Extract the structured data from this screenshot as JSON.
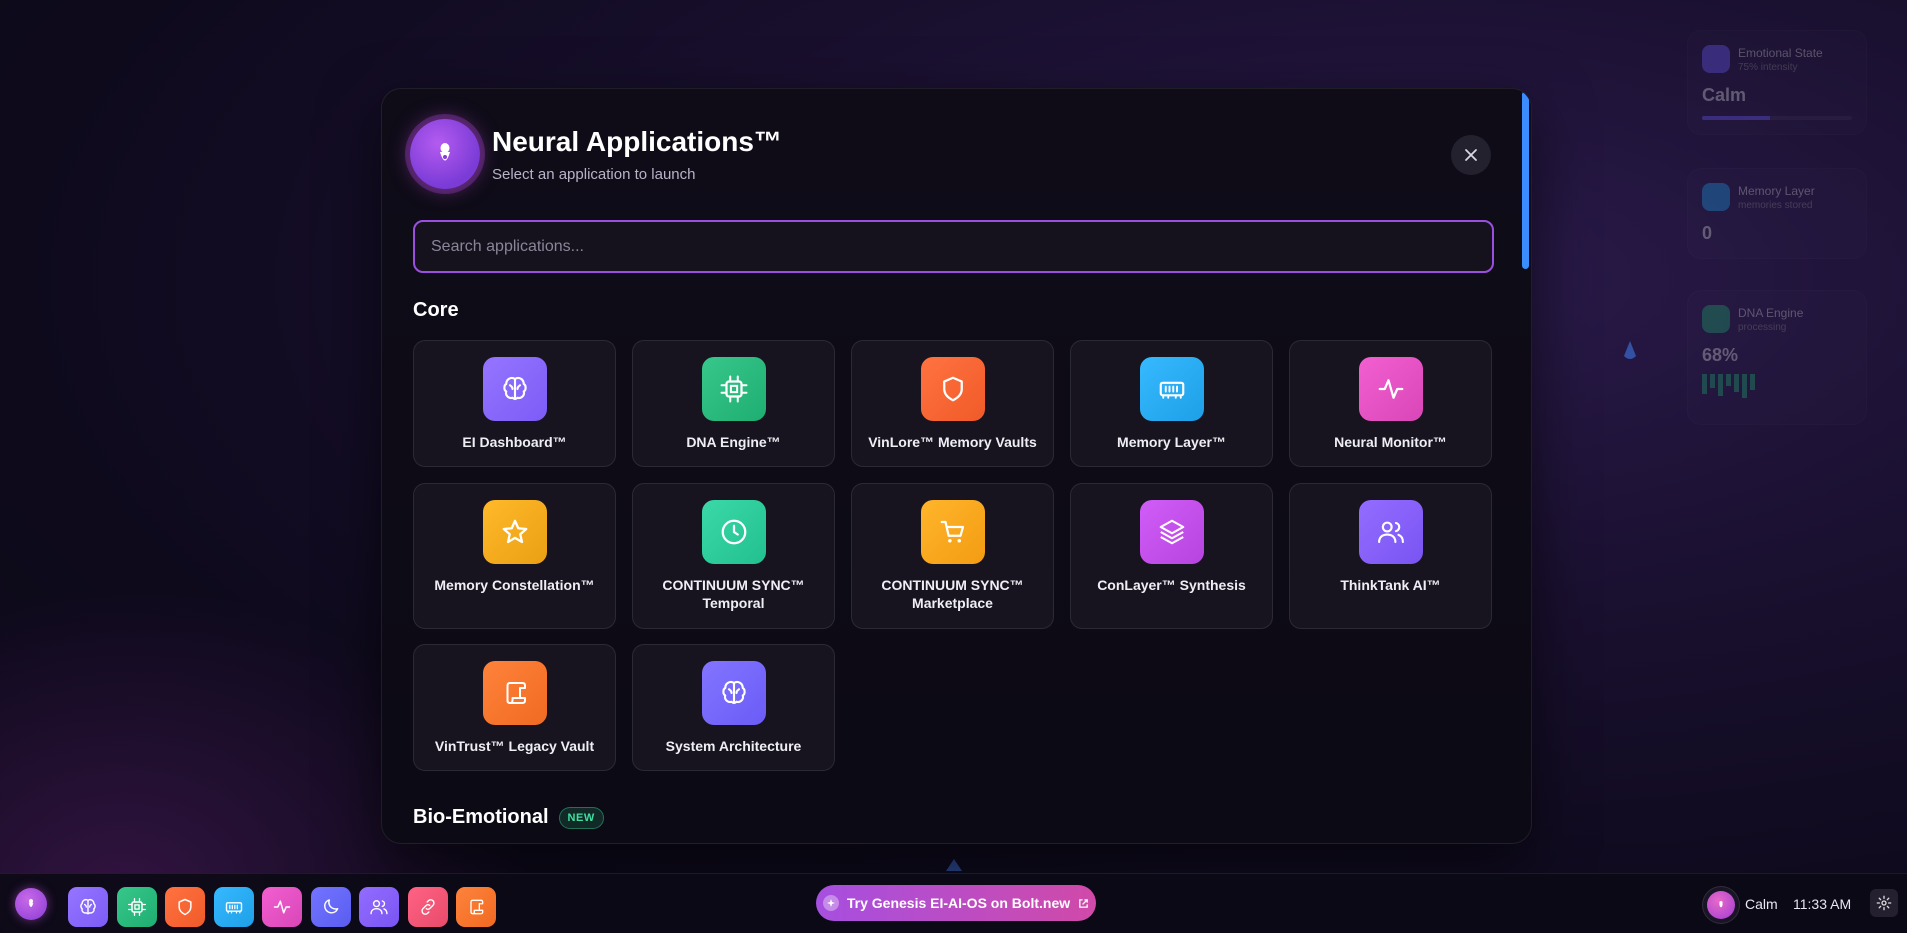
{
  "modal": {
    "title": "Neural Applications™",
    "subtitle": "Select an application to launch",
    "search_placeholder": "Search applications..."
  },
  "sections": {
    "core": "Core",
    "bio": "Bio-Emotional",
    "bio_badge": "NEW"
  },
  "apps": [
    {
      "label": "EI Dashboard™",
      "icon": "brain-icon",
      "color": "#7c5cf6"
    },
    {
      "label": "DNA Engine™",
      "icon": "chip-icon",
      "color": "#1fae72"
    },
    {
      "label": "VinLore™ Memory Vaults",
      "icon": "shield-icon",
      "color": "#f05a28"
    },
    {
      "label": "Memory Layer™",
      "icon": "memory-icon",
      "color": "#1ea0e8"
    },
    {
      "label": "Neural Monitor™",
      "icon": "activity-icon",
      "color": "#d946b8"
    },
    {
      "label": "Memory Constellation™",
      "icon": "star-icon",
      "color": "#eaa012"
    },
    {
      "label": "CONTINUUM SYNC™ Temporal",
      "icon": "clock-icon",
      "color": "#22c08f"
    },
    {
      "label": "CONTINUUM SYNC™ Marketplace",
      "icon": "cart-icon",
      "color": "#f39c12"
    },
    {
      "label": "ConLayer™ Synthesis",
      "icon": "layers-icon",
      "color": "#b844e0"
    },
    {
      "label": "ThinkTank AI™",
      "icon": "users-icon",
      "color": "#7a54f2"
    },
    {
      "label": "VinTrust™ Legacy Vault",
      "icon": "scroll-icon",
      "color": "#f06a22"
    },
    {
      "label": "System Architecture",
      "icon": "brain-icon",
      "color": "#6a5cf6"
    }
  ],
  "taskbar": {
    "apps": [
      {
        "name": "taskbar-ei-dashboard",
        "icon": "brain-icon",
        "color": "#7c5cf6"
      },
      {
        "name": "taskbar-dna-engine",
        "icon": "chip-icon",
        "color": "#1fae72"
      },
      {
        "name": "taskbar-memory-vaults",
        "icon": "shield-icon",
        "color": "#f05a28"
      },
      {
        "name": "taskbar-memory-layer",
        "icon": "memory-icon",
        "color": "#1ea0e8"
      },
      {
        "name": "taskbar-neural-monitor",
        "icon": "activity-icon",
        "color": "#d946b8"
      },
      {
        "name": "taskbar-moon",
        "icon": "moon-icon",
        "color": "#5a5cf0"
      },
      {
        "name": "taskbar-thinktank",
        "icon": "users-icon",
        "color": "#7a54f2"
      },
      {
        "name": "taskbar-link",
        "icon": "link-icon",
        "color": "#e84a6a"
      },
      {
        "name": "taskbar-legacy-vault",
        "icon": "scroll-icon",
        "color": "#f06a22"
      }
    ],
    "promo": "Try Genesis EI-AI-OS on Bolt.new",
    "mood": "Calm",
    "time": "11:33 AM"
  },
  "widgets": {
    "emotional_title": "Emotional State",
    "emotional_sub": "75% intensity",
    "emotional_value": "Calm",
    "memory_title": "Memory Layer",
    "memory_sub": "memories stored",
    "memory_value": "0",
    "dna_title": "DNA Engine",
    "dna_sub": "processing",
    "dna_value": "68%"
  }
}
